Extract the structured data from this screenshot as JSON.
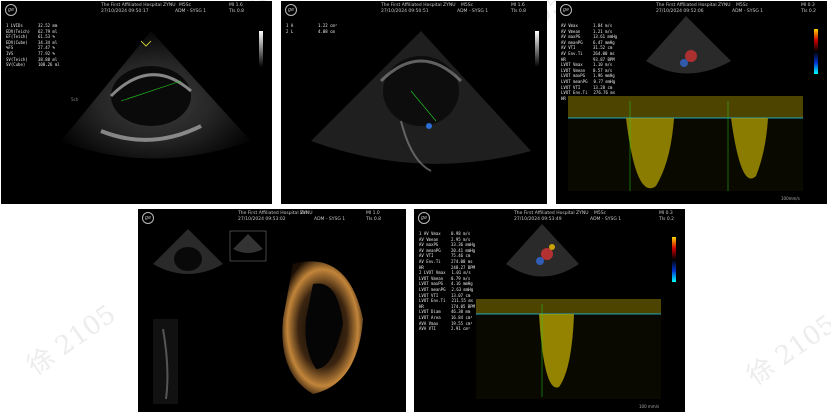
{
  "header": {
    "hospital": "The First Affiliated Hospital ZYNU",
    "p1_datetime": "27/10/2024 09:50:17",
    "p2_datetime": "27/10/2024 09:50:51",
    "p3_datetime": "27/10/2024 09:52:06",
    "p4_datetime": "27/10/2024 09:53:02",
    "p5_datetime": "27/10/2024 09:53:49",
    "probe": "M5Sc",
    "mode": "ADM - SYSG 1",
    "mi": "MI 1.6",
    "tis": "TIs 0.8",
    "mi_b": "MI 0.3",
    "tis_b": "TIs 0.2",
    "mi_c": "MI 1.0"
  },
  "panel1": {
    "measurements": [
      {
        "k": "1 LVIDs",
        "v": "32.52 mm"
      },
      {
        "k": "EDV(Teich)",
        "v": "62.79 ml"
      },
      {
        "k": "EF(Teich)",
        "v": "61.53 %"
      },
      {
        "k": "EDV(Cube)",
        "v": "34.34 ml"
      },
      {
        "k": "%FS",
        "v": "27.47 %"
      },
      {
        "k": "IVS",
        "v": "77.92 %"
      },
      {
        "k": "SV(Teich)",
        "v": "38.88 ml"
      },
      {
        "k": "SV(Cube)",
        "v": "108.26 ml"
      }
    ],
    "scale_label": "5ch"
  },
  "panel2": {
    "measurements": [
      {
        "k": "1 A",
        "v": "1.22 cm²"
      },
      {
        "k": "2 L",
        "v": "4.08 cm"
      }
    ]
  },
  "panel3": {
    "measurements": [
      {
        "k": "AV Vmax",
        "v": "1.84 m/s"
      },
      {
        "k": "AV Vmean",
        "v": "1.21 m/s"
      },
      {
        "k": "AV maxPG",
        "v": "13.61 mmHg"
      },
      {
        "k": "AV meanPG",
        "v": "6.47 mmHg"
      },
      {
        "k": "AV VTI",
        "v": "31.52 cm"
      },
      {
        "k": "AV Env.Ti",
        "v": "264.00 ms"
      },
      {
        "k": "HR",
        "v": "93.87 BPM"
      },
      {
        "k": "LVOT Vmax",
        "v": "1.10 m/s"
      },
      {
        "k": "LVOT Vmean",
        "v": "0.57 m/s"
      },
      {
        "k": "LVOT maxPG",
        "v": "1.96 mmHg"
      },
      {
        "k": "LVOT meanPG",
        "v": "0.77 mmHg"
      },
      {
        "k": "LVOT VTI",
        "v": "13.28 cm"
      },
      {
        "k": "LVOT Env.Ti",
        "v": "276.76 ms"
      },
      {
        "k": "HR",
        "v": "121.19 BPM"
      }
    ],
    "speed": "100mm/s"
  },
  "panel4": {
    "vol_label": "Vol"
  },
  "panel5": {
    "measurements": [
      {
        "k": "1 AV Vmax",
        "v": "0.98 m/s"
      },
      {
        "k": "AV Vmean",
        "v": "2.95 m/s"
      },
      {
        "k": "AV maxPG",
        "v": "33.36 mmHg"
      },
      {
        "k": "AV meanPG",
        "v": "20.41 mmHg"
      },
      {
        "k": "AV VTI",
        "v": "75.46 cm"
      },
      {
        "k": "AV Env.Ti",
        "v": "274.00 ms"
      },
      {
        "k": "HR",
        "v": "248.27 BPM"
      },
      {
        "k": "2 LVOT Vmax",
        "v": "1.01 m/s"
      },
      {
        "k": "LVOT Vmean",
        "v": "0.79 m/s"
      },
      {
        "k": "LVOT maxPG",
        "v": "4.16 mmHg"
      },
      {
        "k": "LVOT meanPG",
        "v": "2.63 mmHg"
      },
      {
        "k": "LVOT VTI",
        "v": "13.07 cm"
      },
      {
        "k": "LVOT Env.Ti",
        "v": "211.55 ms"
      },
      {
        "k": "HR",
        "v": "174.05 BPM"
      },
      {
        "k": "LVOT Diam",
        "v": "46.30 mm"
      },
      {
        "k": "LVOT Area",
        "v": "16.84 cm²"
      },
      {
        "k": "AVA Vmax",
        "v": "19.55 cm²"
      },
      {
        "k": "AVA VTI",
        "v": "2.91 cm²"
      }
    ],
    "speed": "100 mm/s"
  },
  "watermark": "徐 2105",
  "colors": {
    "panel_bg": "#000000",
    "doppler": "#c8b400",
    "baseline": "#19d0ff"
  }
}
